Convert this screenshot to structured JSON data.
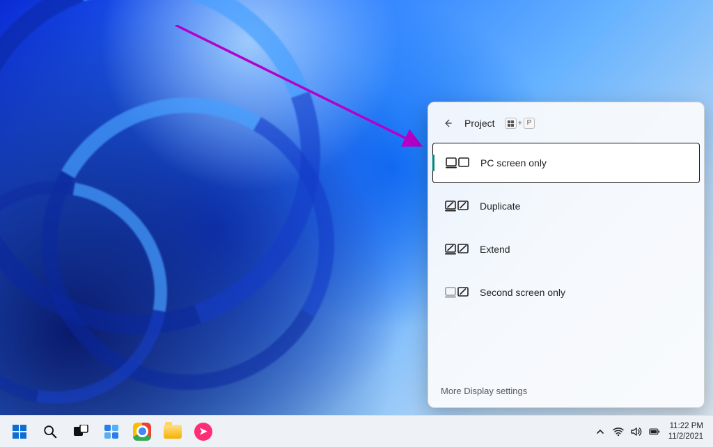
{
  "flyout": {
    "title": "Project",
    "shortcut_plus": "+",
    "shortcut_key": "P",
    "options": [
      {
        "label": "PC screen only"
      },
      {
        "label": "Duplicate"
      },
      {
        "label": "Extend"
      },
      {
        "label": "Second screen only"
      }
    ],
    "more_link": "More Display settings"
  },
  "taskbar": {
    "time": "11:22 PM",
    "date": "11/2/2021"
  }
}
